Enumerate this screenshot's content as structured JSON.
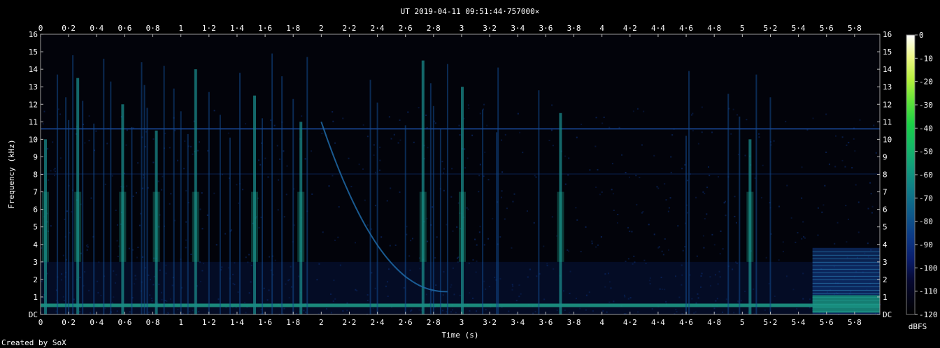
{
  "chart_data": {
    "type": "heatmap",
    "title": "UT 2019-04-11 09:51:44·757000×",
    "xlabel": "Time (s)",
    "ylabel": "Frequency (kHz)",
    "xlim": [
      0,
      5.98
    ],
    "ylim": [
      0,
      16
    ],
    "x_ticks": [
      "0",
      "0·2",
      "0·4",
      "0·6",
      "0·8",
      "1",
      "1·2",
      "1·4",
      "1·6",
      "1·8",
      "2",
      "2·2",
      "2·4",
      "2·6",
      "2·8",
      "3",
      "3·2",
      "3·4",
      "3·6",
      "3·8",
      "4",
      "4·2",
      "4·4",
      "4·6",
      "4·8",
      "5",
      "5·2",
      "5·4",
      "5·6",
      "5·8"
    ],
    "y_ticks": [
      "DC",
      "1",
      "2",
      "3",
      "4",
      "5",
      "6",
      "7",
      "8",
      "9",
      "10",
      "11",
      "12",
      "13",
      "14",
      "15",
      "16"
    ],
    "colorbar": {
      "label": "dBFS",
      "range": [
        -120,
        0
      ],
      "ticks": [
        "0",
        "-10",
        "-20",
        "-30",
        "-40",
        "-50",
        "-60",
        "-70",
        "-80",
        "-90",
        "-100",
        "-110",
        "-120"
      ]
    },
    "features": {
      "baseline_band_khz": 0.5,
      "horizontal_tone_khz": 10.6,
      "horizontal_tone_2_khz": 8.0,
      "vertical_bursts_s": [
        0.03,
        0.12,
        0.18,
        0.2,
        0.23,
        0.26,
        0.3,
        0.38,
        0.45,
        0.5,
        0.58,
        0.65,
        0.72,
        0.74,
        0.76,
        0.82,
        0.88,
        0.95,
        1.0,
        1.05,
        1.1,
        1.2,
        1.28,
        1.35,
        1.42,
        1.52,
        1.58,
        1.65,
        1.72,
        1.8,
        1.85,
        1.9,
        2.35,
        2.4,
        2.6,
        2.72,
        2.78,
        2.8,
        2.85,
        2.9,
        3.0,
        3.15,
        3.25,
        3.26,
        3.55,
        3.7,
        4.6,
        4.62,
        4.9,
        4.98,
        5.05,
        5.1,
        5.2
      ],
      "sweep": {
        "start_s": 2.0,
        "end_s": 2.9,
        "start_khz": 11,
        "end_khz": 1.3
      },
      "end_block": {
        "start_s": 5.5,
        "end_s": 5.98,
        "top_khz": 3.8
      }
    }
  },
  "footer": {
    "credit": "Created by SoX"
  }
}
